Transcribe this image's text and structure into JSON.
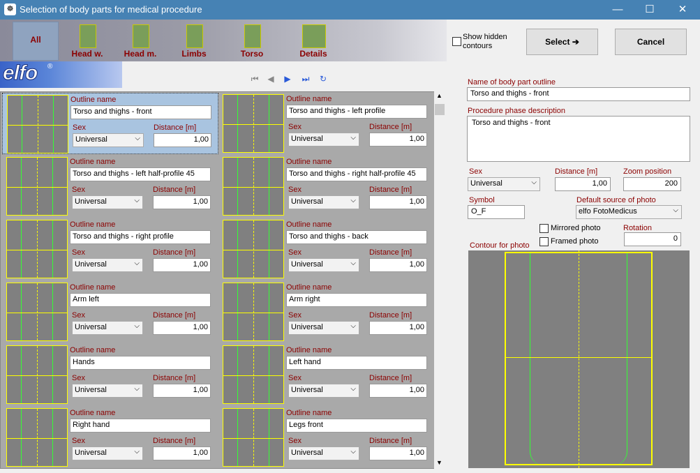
{
  "window": {
    "title": "Selection of body parts for medical procedure",
    "minimize": "—",
    "maximize": "☐",
    "close": "✕",
    "app_icon": "☸"
  },
  "toolbar": {
    "buttons": [
      "All",
      "Head w.",
      "Head m.",
      "Limbs",
      "Torso",
      "Details"
    ]
  },
  "logo": {
    "text": "elfo",
    "mark": "®"
  },
  "nav": {
    "first": "⏮",
    "prev": "◀",
    "next": "▶",
    "last": "⏭",
    "refresh": "↻"
  },
  "options": {
    "show_hidden": "Show hidden contours"
  },
  "actions": {
    "select": "Select ➔",
    "cancel": "Cancel"
  },
  "labels": {
    "outline_name": "Outline name",
    "sex": "Sex",
    "distance": "Distance [m]"
  },
  "items": [
    {
      "name": "Torso and thighs - front",
      "sex": "Universal",
      "distance": "1,00"
    },
    {
      "name": "Torso and thighs - left profile",
      "sex": "Universal",
      "distance": "1,00"
    },
    {
      "name": "Torso and thighs - left half-profile 45",
      "sex": "Universal",
      "distance": "1,00"
    },
    {
      "name": "Torso and thighs - right half-profile 45",
      "sex": "Universal",
      "distance": "1,00"
    },
    {
      "name": "Torso and thighs - right profile",
      "sex": "Universal",
      "distance": "1,00"
    },
    {
      "name": "Torso and thighs - back",
      "sex": "Universal",
      "distance": "1,00"
    },
    {
      "name": "Arm left",
      "sex": "Universal",
      "distance": "1,00"
    },
    {
      "name": "Arm right",
      "sex": "Universal",
      "distance": "1,00"
    },
    {
      "name": "Hands",
      "sex": "Universal",
      "distance": "1,00"
    },
    {
      "name": "Left hand",
      "sex": "Universal",
      "distance": "1,00"
    },
    {
      "name": "Right hand",
      "sex": "Universal",
      "distance": "1,00"
    },
    {
      "name": "Legs front",
      "sex": "Universal",
      "distance": "1,00"
    }
  ],
  "detail": {
    "name_label": "Name of body part outline",
    "name": "Torso and thighs - front",
    "phase_label": "Procedure phase description",
    "phase": "Torso and thighs - front",
    "sex_label": "Sex",
    "sex": "Universal",
    "distance_label": "Distance [m]",
    "distance": "1,00",
    "zoom_label": "Zoom position",
    "zoom": "200",
    "symbol_label": "Symbol",
    "symbol": "O_F",
    "source_label": "Default source of photo",
    "source": "elfo FotoMedicus",
    "mirrored": "Mirrored photo",
    "framed": "Framed photo",
    "rotation_label": "Rotation",
    "rotation": "0",
    "contour_label": "Contour for photo"
  },
  "colors": {
    "accent": "#4682b4",
    "label": "#8b0000",
    "contour_frame": "#ffff00",
    "contour_line": "#33ff33"
  }
}
